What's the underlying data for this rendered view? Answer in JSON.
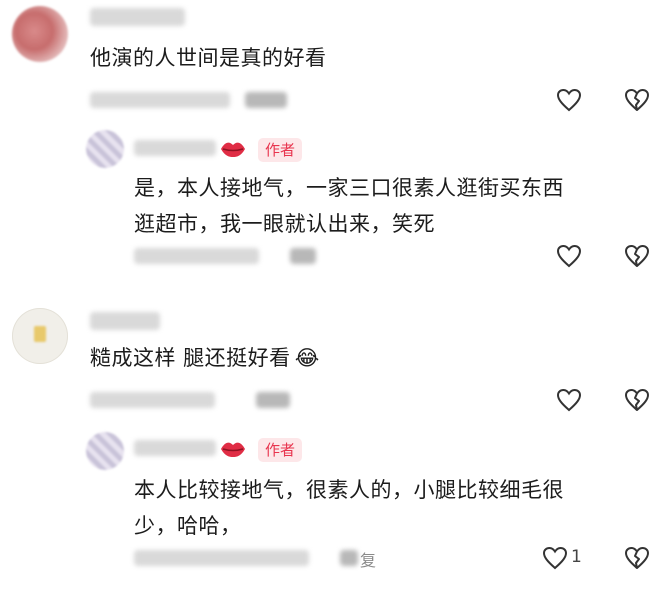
{
  "comments": [
    {
      "text": "他演的人世间是真的好看"
    },
    {
      "author_badge": "作者",
      "text_lines": [
        "是，本人接地气，一家三口很素人逛街买东西",
        "逛超市，我一眼就认出来，笑死"
      ]
    },
    {
      "text": "糙成这样 腿还挺好看",
      "emoji": "😂"
    },
    {
      "author_badge": "作者",
      "text_lines": [
        "本人比较接地气，很素人的，小腿比较细毛很",
        "少，哈哈，"
      ],
      "reply_label": "复",
      "like_count": "1"
    }
  ],
  "icons": {
    "like": "heart-outline-icon",
    "dislike": "broken-heart-outline-icon",
    "author_tag": "lips-icon"
  },
  "colors": {
    "badge_bg": "#fde7e9",
    "badge_text": "#e8344e",
    "icon_stroke": "#333333",
    "meta_text": "#8a8a8a"
  }
}
